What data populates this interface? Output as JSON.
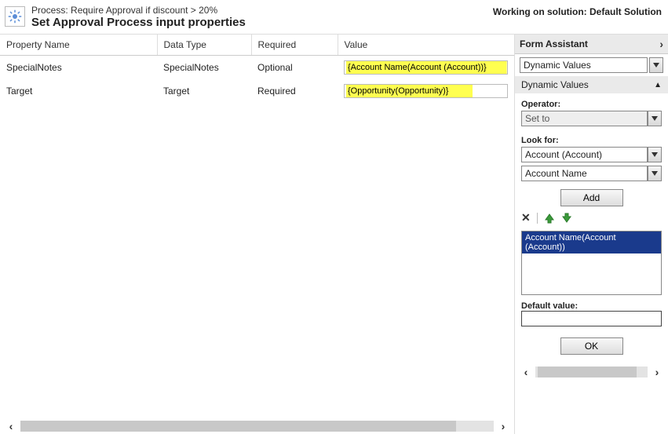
{
  "header": {
    "process_label": "Process:",
    "process_name": "Require Approval if discount > 20%",
    "title": "Set Approval Process input properties",
    "working_on_label": "Working on solution:",
    "solution_name": "Default Solution"
  },
  "columns": {
    "prop": "Property Name",
    "type": "Data Type",
    "req": "Required",
    "val": "Value"
  },
  "rows": [
    {
      "prop": "SpecialNotes",
      "type": "SpecialNotes",
      "req": "Optional",
      "val": "{Account Name(Account (Account))}"
    },
    {
      "prop": "Target",
      "type": "Target",
      "req": "Required",
      "val": "{Opportunity(Opportunity)}"
    }
  ],
  "form_assistant": {
    "title": "Form Assistant",
    "top_select": "Dynamic Values",
    "dv_label": "Dynamic Values",
    "operator_label": "Operator:",
    "operator_value": "Set to",
    "lookfor_label": "Look for:",
    "lookfor_entity": "Account (Account)",
    "lookfor_attr": "Account Name",
    "add_label": "Add",
    "list_item": "Account Name(Account (Account))",
    "default_label": "Default value:",
    "default_value": "",
    "ok_label": "OK"
  }
}
